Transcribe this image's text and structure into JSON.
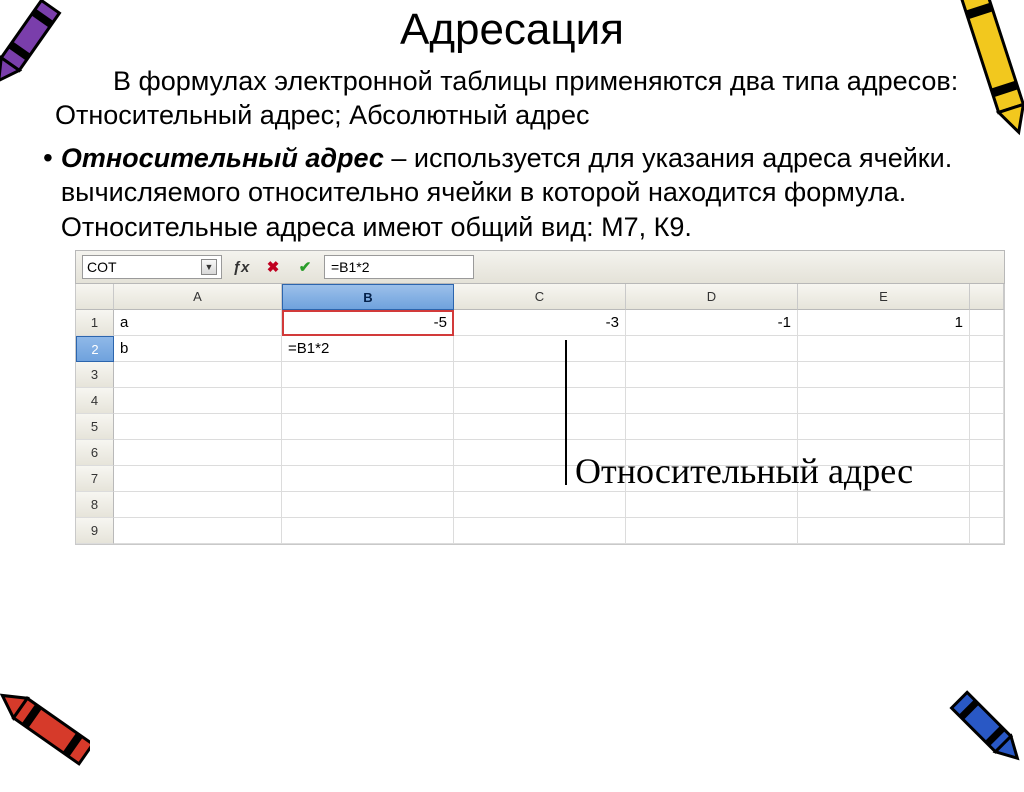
{
  "title": "Адресация",
  "intro": "В формулах электронной таблицы применяются два типа адресов:  Относительный адрес; Абсолютный адрес",
  "bullet": {
    "term": "Относительный адрес",
    "desc": " – используется для указания адреса ячейки. вычисляемого относительно ячейки в которой находится формула. Относительные адреса имеют общий вид: М7, К9."
  },
  "sheet": {
    "namebox": "COT",
    "formula": "=B1*2",
    "columns": [
      "A",
      "B",
      "C",
      "D",
      "E"
    ],
    "rows": [
      {
        "n": "1",
        "A": "a",
        "B": "-5",
        "C": "-3",
        "D": "-1",
        "E": "1"
      },
      {
        "n": "2",
        "A": "b",
        "B": "=B1*2",
        "C": "",
        "D": "",
        "E": ""
      },
      {
        "n": "3",
        "A": "",
        "B": "",
        "C": "",
        "D": "",
        "E": ""
      },
      {
        "n": "4",
        "A": "",
        "B": "",
        "C": "",
        "D": "",
        "E": ""
      },
      {
        "n": "5",
        "A": "",
        "B": "",
        "C": "",
        "D": "",
        "E": ""
      },
      {
        "n": "6",
        "A": "",
        "B": "",
        "C": "",
        "D": "",
        "E": ""
      },
      {
        "n": "7",
        "A": "",
        "B": "",
        "C": "",
        "D": "",
        "E": ""
      },
      {
        "n": "8",
        "A": "",
        "B": "",
        "C": "",
        "D": "",
        "E": ""
      },
      {
        "n": "9",
        "A": "",
        "B": "",
        "C": "",
        "D": "",
        "E": ""
      }
    ],
    "callout": "Относительный адрес"
  }
}
